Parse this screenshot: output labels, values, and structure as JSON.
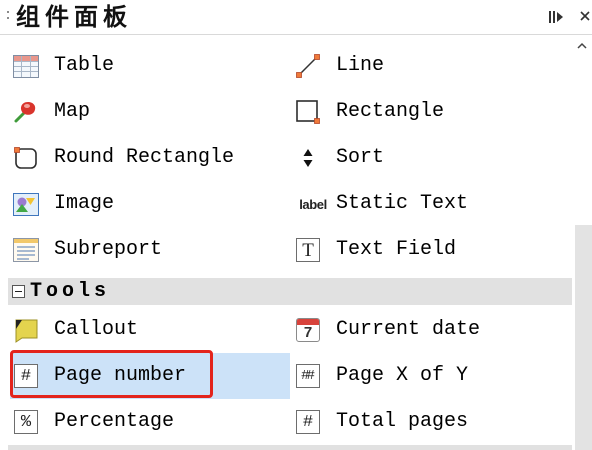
{
  "panel": {
    "title": "组件面板"
  },
  "header_icons": [
    "drag-handle",
    "minimize-panel-icon",
    "close-icon"
  ],
  "elements": {
    "items": [
      {
        "label": "Table",
        "icon": "table-icon"
      },
      {
        "label": "Line",
        "icon": "line-icon"
      },
      {
        "label": "Map",
        "icon": "map-pin-icon"
      },
      {
        "label": "Rectangle",
        "icon": "rectangle-icon"
      },
      {
        "label": "Round Rectangle",
        "icon": "round-rectangle-icon"
      },
      {
        "label": "Sort",
        "icon": "sort-arrows-icon"
      },
      {
        "label": "Image",
        "icon": "image-icon"
      },
      {
        "label": "Static Text",
        "icon": "static-text-label-icon",
        "glyph": "label"
      },
      {
        "label": "Subreport",
        "icon": "subreport-icon"
      },
      {
        "label": "Text Field",
        "icon": "text-field-icon",
        "glyph": "T"
      }
    ]
  },
  "tools": {
    "label": "Tools",
    "collapsed": false,
    "items": [
      {
        "label": "Callout",
        "icon": "callout-note-icon"
      },
      {
        "label": "Current date",
        "icon": "calendar-icon",
        "glyph": "7"
      },
      {
        "label": "Page number",
        "icon": "page-number-icon",
        "glyph": "#",
        "selected": true,
        "annotated": true
      },
      {
        "label": "Page X of Y",
        "icon": "page-x-of-y-icon",
        "glyph": "##"
      },
      {
        "label": "Percentage",
        "icon": "percentage-icon",
        "glyph": "%"
      },
      {
        "label": "Total pages",
        "icon": "total-pages-icon",
        "glyph": "#"
      }
    ]
  },
  "scrollbar_icons": [
    "scroll-up-arrow-icon"
  ],
  "colors": {
    "selection": "#cce2f8",
    "annotation": "#e3241c",
    "section_band": "#e1e1e1",
    "scroll_thumb": "#e3e3e3"
  }
}
